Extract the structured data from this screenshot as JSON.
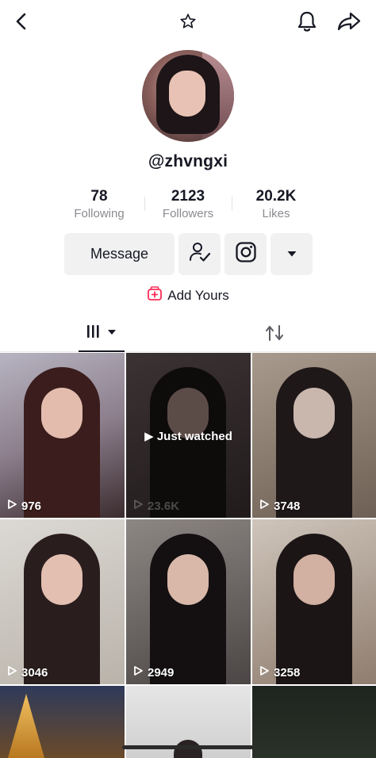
{
  "profile": {
    "username": "@zhvngxi",
    "stats": [
      {
        "value": "78",
        "label": "Following"
      },
      {
        "value": "2123",
        "label": "Followers"
      },
      {
        "value": "20.2K",
        "label": "Likes"
      }
    ]
  },
  "actions": {
    "message_label": "Message",
    "follow_icon": "user-check-icon",
    "instagram_icon": "instagram-icon",
    "more_icon": "caret-down-icon"
  },
  "add_yours": {
    "label": "Add Yours",
    "icon": "add-yours-icon",
    "color": "#fe2c55"
  },
  "tabs": [
    {
      "name": "videos",
      "icon": "grid-icon",
      "active": true
    },
    {
      "name": "reposts",
      "icon": "repost-icon",
      "active": false
    }
  ],
  "videos": [
    {
      "views": "976"
    },
    {
      "views": "23.6K",
      "status": "Just watched"
    },
    {
      "views": "3748"
    },
    {
      "views": "3046"
    },
    {
      "views": "2949"
    },
    {
      "views": "3258"
    },
    {
      "views": ""
    },
    {
      "views": ""
    },
    {
      "views": ""
    }
  ],
  "colors": {
    "text": "#161823",
    "muted": "#8a8b91",
    "button_bg": "#f1f1f2"
  }
}
